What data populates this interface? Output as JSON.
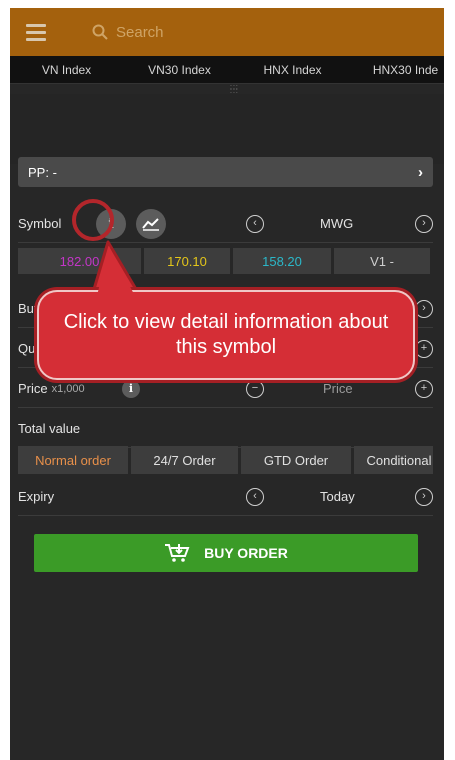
{
  "search": {
    "placeholder": "Search"
  },
  "indices": [
    "VN Index",
    "VN30 Index",
    "HNX Index",
    "HNX30 Inde"
  ],
  "pp": {
    "label": "PP: -"
  },
  "symbol_row": {
    "label": "Symbol",
    "value": "MWG"
  },
  "prices": [
    {
      "value": "182.00",
      "color": "#c336c7"
    },
    {
      "value": "170.10",
      "color": "#e3c51a"
    },
    {
      "value": "158.20",
      "color": "#2bb8c9"
    },
    {
      "value": "V1 -",
      "color": "#cfcfcf"
    }
  ],
  "buy_row": {
    "label": "Buy"
  },
  "quantity_row": {
    "label": "Qua"
  },
  "price_row": {
    "label": "Price",
    "unit": "x1,000",
    "placeholder": "Price"
  },
  "total": {
    "label": "Total value"
  },
  "order_tabs": [
    {
      "label": "Normal order",
      "active": true
    },
    {
      "label": "24/7 Order",
      "active": false
    },
    {
      "label": "GTD Order",
      "active": false
    },
    {
      "label": "Conditional",
      "active": false
    }
  ],
  "expiry": {
    "label": "Expiry",
    "value": "Today"
  },
  "buy_button": {
    "label": "BUY ORDER"
  },
  "callout": {
    "text": "Click to view detail information about this symbol"
  },
  "colors": {
    "accent_orange": "#a4610d",
    "buy_green": "#3b9b27",
    "callout_red": "#d52e36",
    "active_tab": "#e8904a"
  },
  "icons": [
    "menu-icon",
    "search-icon",
    "info-icon",
    "chart-icon",
    "chevron-left-icon",
    "chevron-right-icon",
    "minus-icon",
    "plus-icon",
    "cart-icon"
  ]
}
